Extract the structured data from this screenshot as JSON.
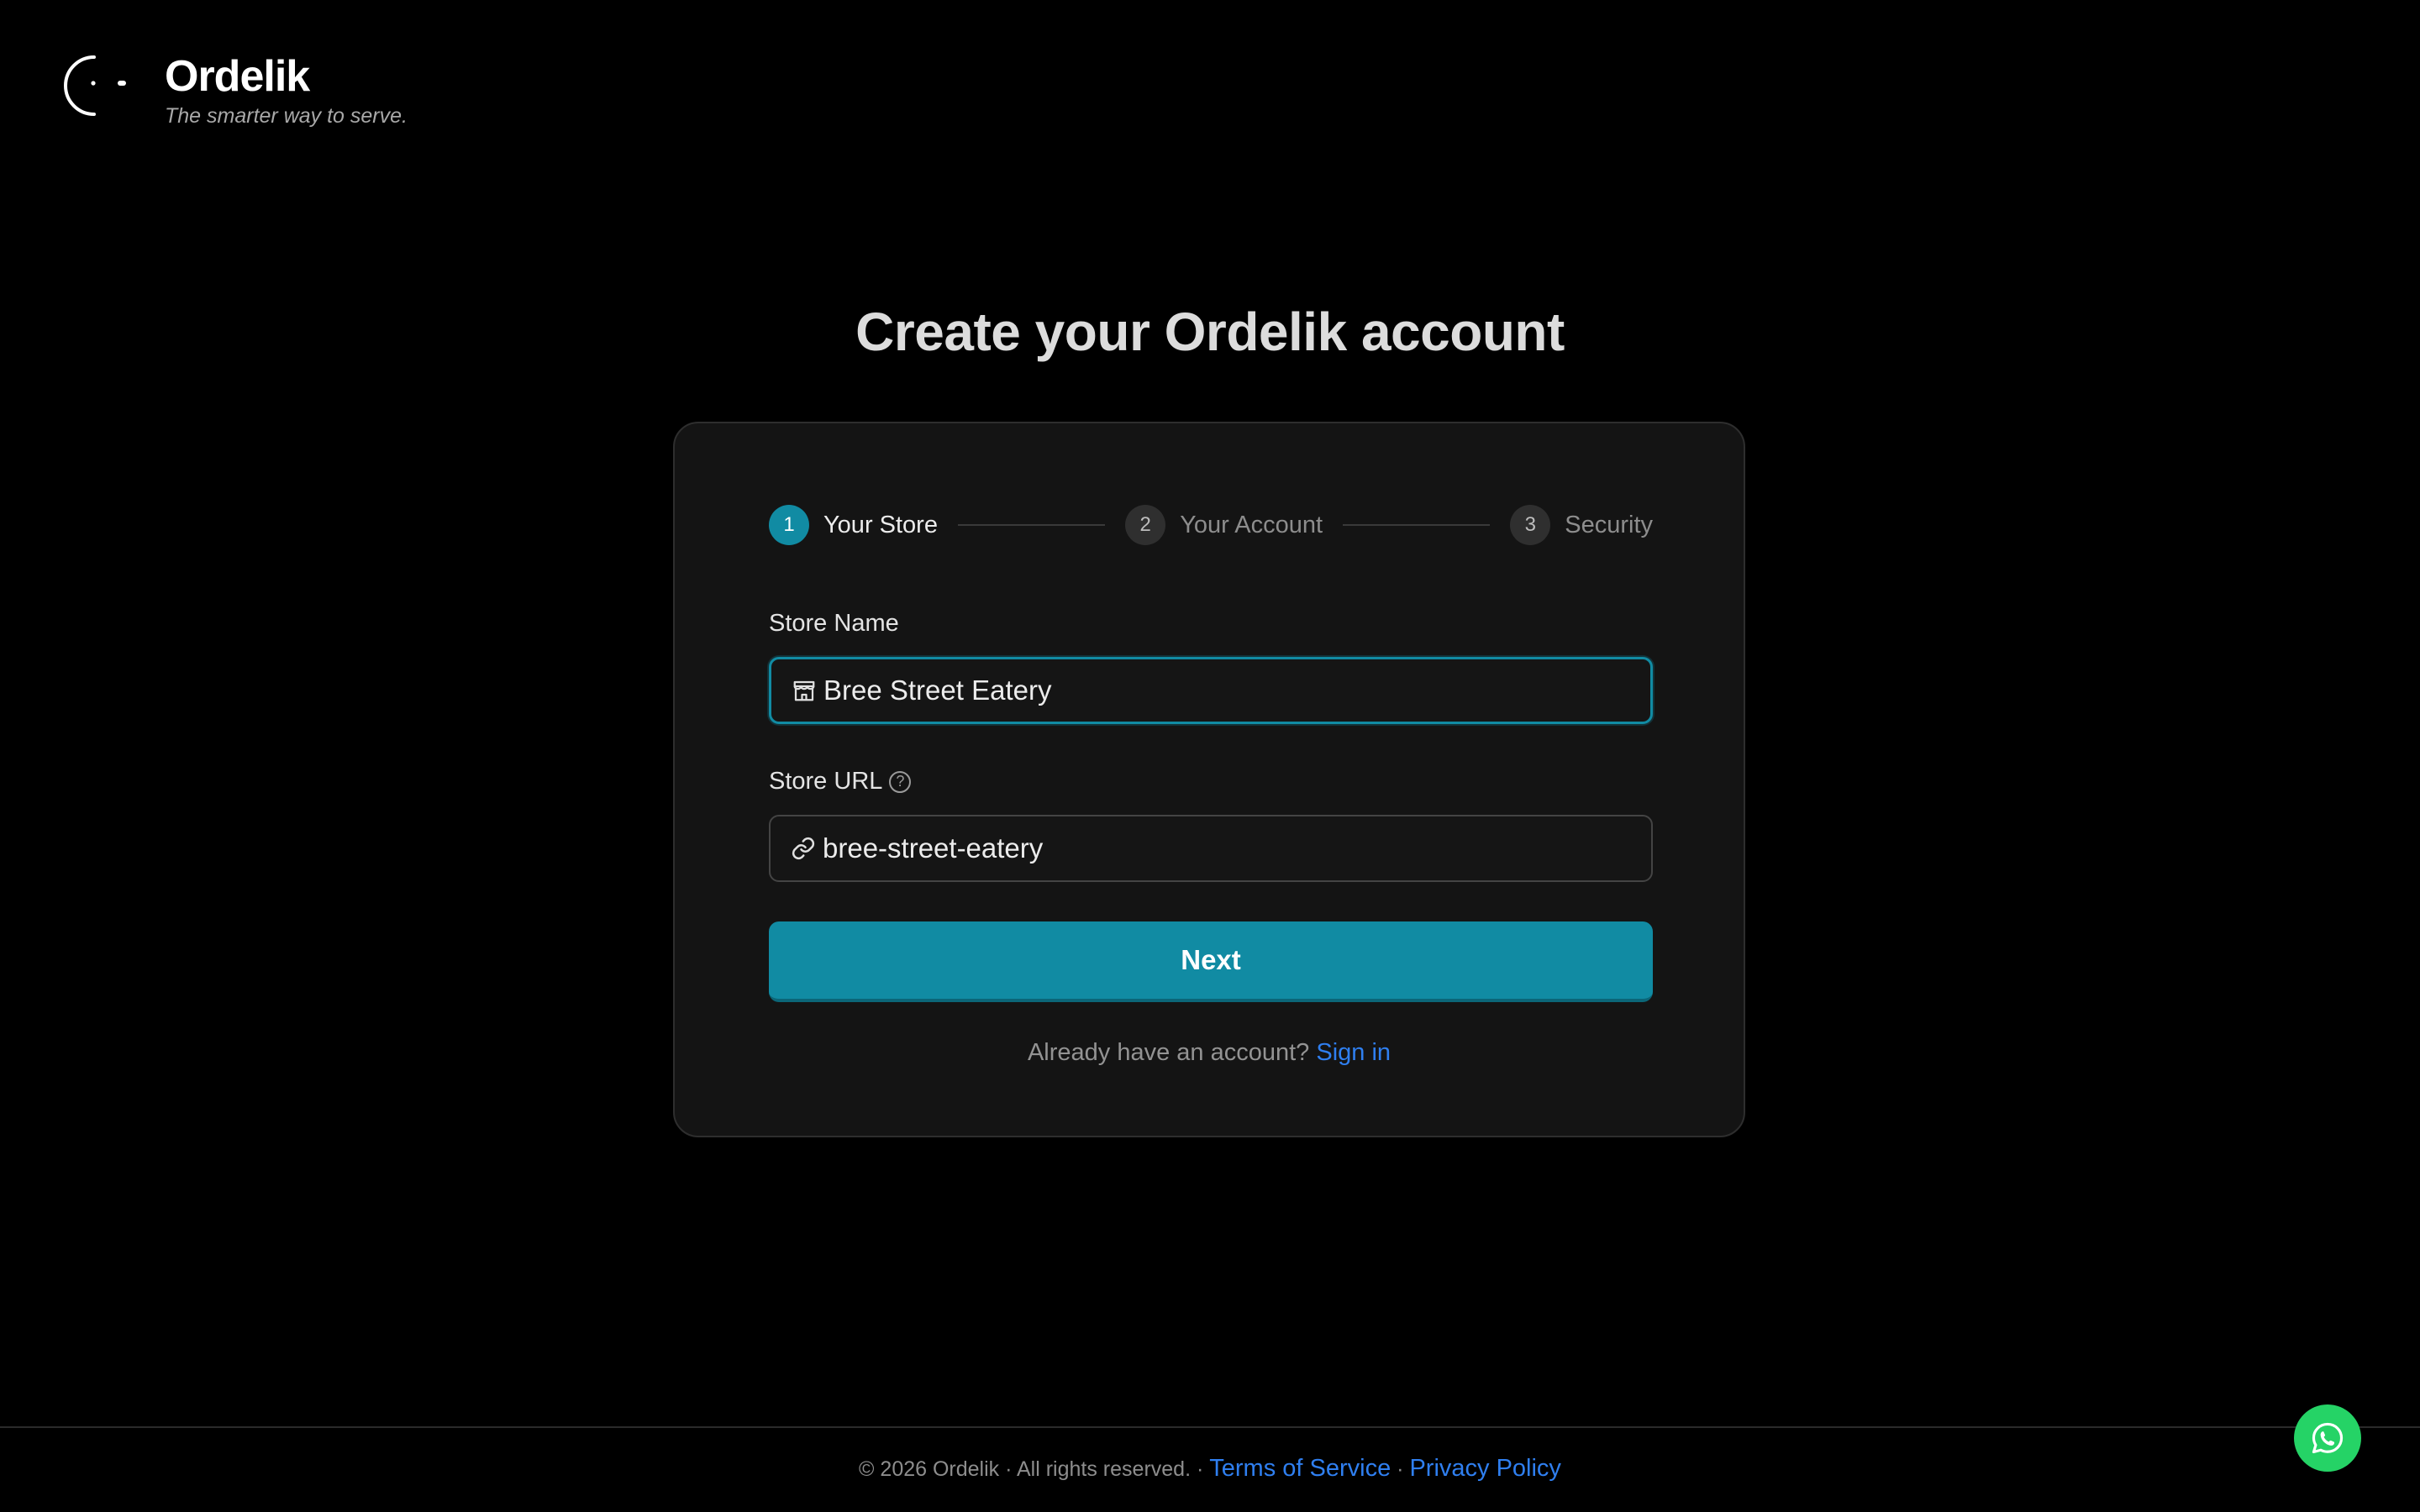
{
  "brand": {
    "name": "Ordelik",
    "tagline": "The smarter way to serve.",
    "logo_icon": "ordelik-logo-icon"
  },
  "page_title": "Create your Ordelik account",
  "stepper": {
    "steps": [
      {
        "number": "1",
        "label": "Your Store",
        "active": true
      },
      {
        "number": "2",
        "label": "Your Account",
        "active": false
      },
      {
        "number": "3",
        "label": "Security",
        "active": false
      }
    ]
  },
  "form": {
    "store_name": {
      "label": "Store Name",
      "value": "Bree Street Eatery",
      "icon": "storefront-icon"
    },
    "store_url": {
      "label": "Store URL",
      "help": "?",
      "value": "bree-street-eatery",
      "icon": "link-icon"
    },
    "next_label": "Next",
    "signin_prompt": "Already have an account?",
    "signin_link": "Sign in"
  },
  "footer": {
    "copyright": "© 2026 Ordelik · All rights reserved. ·",
    "terms": "Terms of Service",
    "separator": "·",
    "privacy": "Privacy Policy"
  },
  "chat_button_icon": "whatsapp-icon",
  "colors": {
    "accent": "#118ba3",
    "link": "#2f7ff0",
    "whatsapp": "#25d366",
    "background": "#000000",
    "card": "#141414"
  }
}
